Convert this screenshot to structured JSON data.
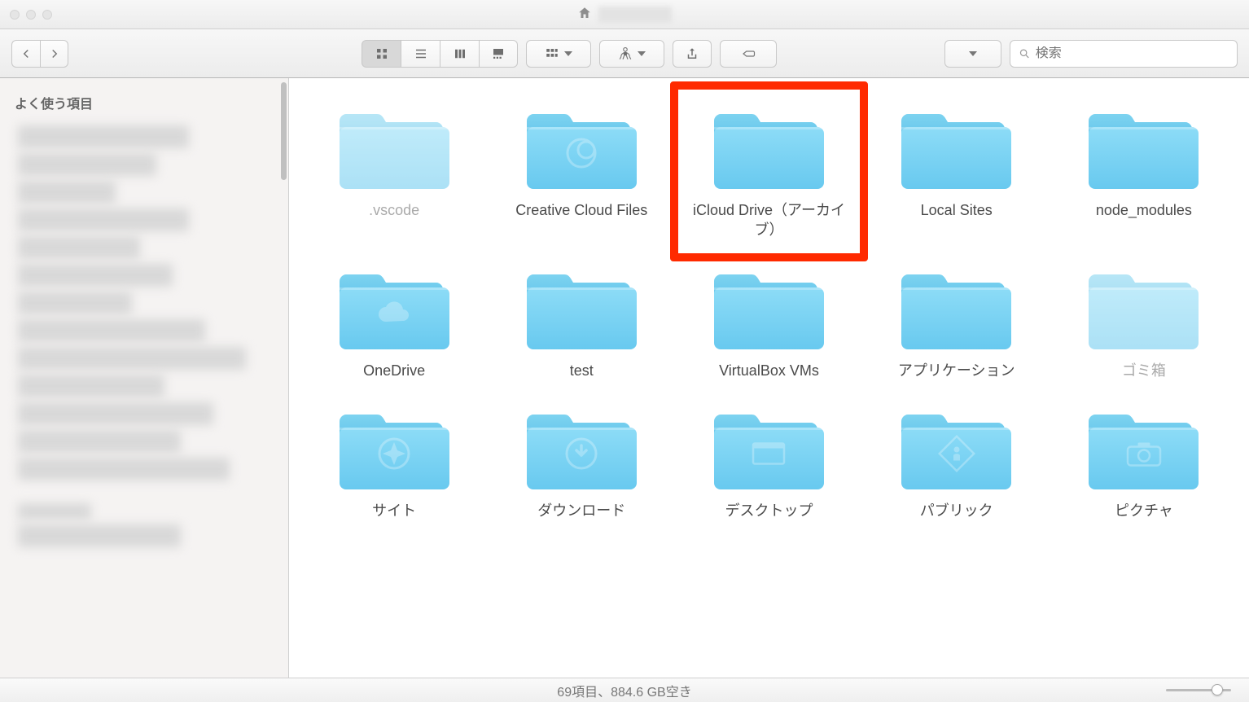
{
  "sidebar": {
    "favorites_label": "よく使う項目"
  },
  "toolbar": {
    "search_placeholder": "検索"
  },
  "folders": [
    {
      "label": ".vscode",
      "icon": "none",
      "dimmed": true
    },
    {
      "label": "Creative Cloud Files",
      "icon": "cc",
      "dimmed": false
    },
    {
      "label": "iCloud Drive（アーカイブ）",
      "icon": "none",
      "dimmed": false,
      "highlighted": true
    },
    {
      "label": "Local Sites",
      "icon": "none",
      "dimmed": false
    },
    {
      "label": "node_modules",
      "icon": "none",
      "dimmed": false
    },
    {
      "label": "OneDrive",
      "icon": "cloud",
      "dimmed": false
    },
    {
      "label": "test",
      "icon": "none",
      "dimmed": false
    },
    {
      "label": "VirtualBox VMs",
      "icon": "none",
      "dimmed": false
    },
    {
      "label": "アプリケーション",
      "icon": "none",
      "dimmed": false
    },
    {
      "label": "ゴミ箱",
      "icon": "none",
      "dimmed": true
    },
    {
      "label": "サイト",
      "icon": "compass",
      "dimmed": false
    },
    {
      "label": "ダウンロード",
      "icon": "download",
      "dimmed": false
    },
    {
      "label": "デスクトップ",
      "icon": "desktop",
      "dimmed": false
    },
    {
      "label": "パブリック",
      "icon": "public",
      "dimmed": false
    },
    {
      "label": "ピクチャ",
      "icon": "camera",
      "dimmed": false
    }
  ],
  "status": {
    "text": "69項目、884.6 GB空き"
  }
}
